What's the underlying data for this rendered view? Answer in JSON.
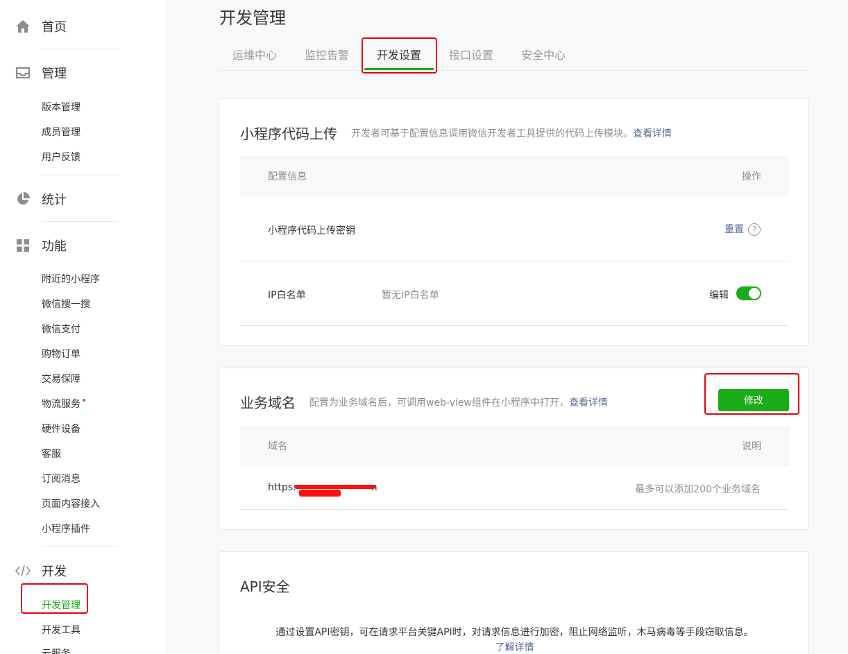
{
  "sidebar": {
    "home": "首页",
    "manage": {
      "title": "管理",
      "items": [
        "版本管理",
        "成员管理",
        "用户反馈"
      ]
    },
    "stats": {
      "title": "统计"
    },
    "features": {
      "title": "功能",
      "items": [
        "附近的小程序",
        "微信搜一搜",
        "微信支付",
        "购物订单",
        "交易保障",
        "物流服务",
        "硬件设备",
        "客服",
        "订阅消息",
        "页面内容接入",
        "小程序插件"
      ]
    },
    "dev": {
      "title": "开发",
      "items": [
        "开发管理",
        "开发工具",
        "云服务"
      ]
    }
  },
  "page": {
    "title": "开发管理",
    "tabs": [
      "运维中心",
      "监控告警",
      "开发设置",
      "接口设置",
      "安全中心"
    ],
    "active_tab": "开发设置"
  },
  "upload": {
    "title": "小程序代码上传",
    "desc": "开发者可基于配置信息调用微信开发者工具提供的代码上传模块。",
    "link": "查看详情",
    "col_config": "配置信息",
    "col_action": "操作",
    "rows": [
      {
        "label": "小程序代码上传密钥",
        "action": "重置"
      },
      {
        "label": "IP白名单",
        "value": "暂无IP白名单",
        "action": "编辑"
      }
    ]
  },
  "domain": {
    "title": "业务域名",
    "desc": "配置为业务域名后，可调用web-view组件在小程序中打开，",
    "link": "查看详情",
    "button": "修改",
    "col_domain": "域名",
    "col_note": "说明",
    "row": {
      "domain_prefix": "https:",
      "domain_suffix": "n",
      "note": "最多可以添加200个业务域名"
    }
  },
  "api": {
    "title": "API安全",
    "desc": "通过设置API密钥，可在请求平台关键API时，对请求信息进行加密，阻止网络监听，木马病毒等手段窃取信息。",
    "link": "了解详情"
  },
  "colors": {
    "accent": "#1aad19",
    "link": "#576b95",
    "highlight": "#e60012"
  },
  "icons": [
    "home-icon",
    "inbox-icon",
    "pie-chart-icon",
    "grid-icon",
    "code-icon",
    "question-icon"
  ]
}
